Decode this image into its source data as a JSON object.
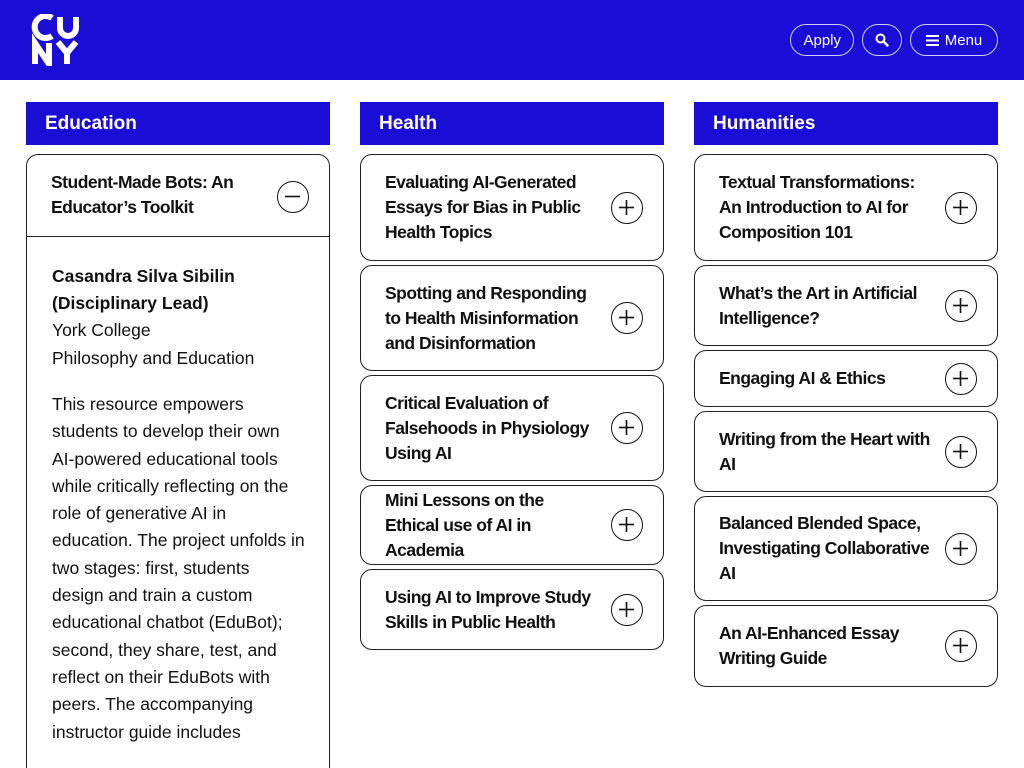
{
  "header": {
    "logo_alt": "CUNY",
    "apply_label": "Apply",
    "menu_label": "Menu",
    "brand_color": "#1a0dd6"
  },
  "columns": [
    {
      "heading": "Education",
      "items": [
        {
          "title": "Student-Made Bots: An Educator’s Toolkit",
          "expanded": true,
          "lead": "Casandra Silva Sibilin (Disciplinary Lead)",
          "college": "York College",
          "department": "Philosophy and Education",
          "description": "This resource empowers students to develop their own AI-powered educational tools while critically reflecting on the role of generative AI in education. The project unfolds in two stages: first, students design and train a custom educational chatbot (EduBot); second, they share, test, and reflect on their EduBots with peers. The accompanying instructor guide includes"
        }
      ]
    },
    {
      "heading": "Health",
      "items": [
        {
          "title": "Evaluating AI-Generated Essays for Bias in Public Health Topics"
        },
        {
          "title": "Spotting and Responding to Health Misinformation and Disinformation"
        },
        {
          "title": "Critical Evaluation of Falsehoods in Physiology Using AI"
        },
        {
          "title": "Mini Lessons on the Ethical use of AI in Academia"
        },
        {
          "title": "Using AI to Improve Study Skills in Public Health"
        }
      ]
    },
    {
      "heading": "Humanities",
      "items": [
        {
          "title": "Textual Transformations: An Introduction to AI for Composition 101"
        },
        {
          "title": "What’s the Art in Artificial Intelligence?"
        },
        {
          "title": "Engaging AI & Ethics"
        },
        {
          "title": "Writing from the Heart with AI"
        },
        {
          "title": "Balanced Blended Space, Investigating Collaborative AI"
        },
        {
          "title": "An AI-Enhanced Essay Writing Guide"
        }
      ]
    }
  ]
}
